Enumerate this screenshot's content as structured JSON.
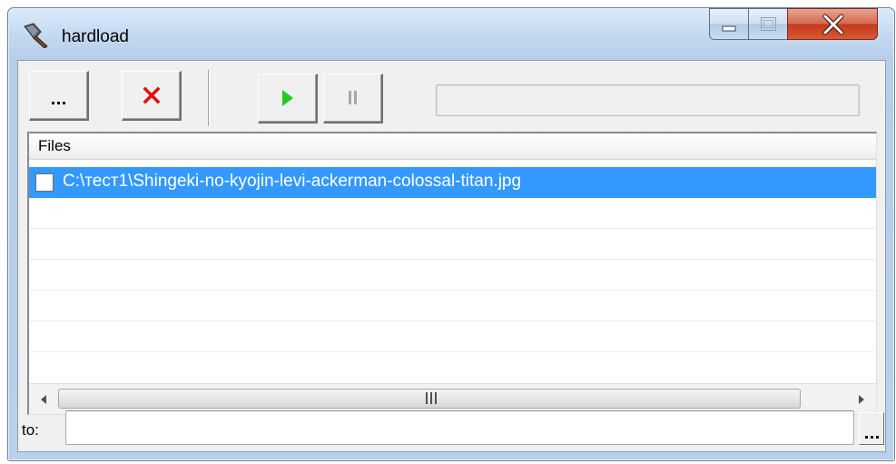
{
  "window": {
    "title": "hardload",
    "controls": [
      "minimize-icon",
      "maximize-icon",
      "close-icon"
    ]
  },
  "toolbar": {
    "buttons": [
      {
        "name": "open-button",
        "icon": "ellipsis-icon"
      },
      {
        "name": "remove-button",
        "icon": "red-x-icon"
      },
      {
        "name": "start-button",
        "icon": "green-play-icon"
      },
      {
        "name": "pause-button",
        "icon": "pause-icon"
      }
    ],
    "progress": 0
  },
  "file_list": {
    "column_header": "Files",
    "rows": [
      {
        "path": "C:\\тест1\\Shingeki-no-kyojin-levi-ackerman-colossal-titan.jpg",
        "checked": false,
        "selected": true
      }
    ],
    "scrollbar_grip": "III"
  },
  "destination": {
    "label": "to:",
    "value": ""
  },
  "colors": {
    "selection": "#3399ff",
    "play": "#22cc22",
    "remove": "#e01010",
    "close_button": "#c3391c"
  }
}
